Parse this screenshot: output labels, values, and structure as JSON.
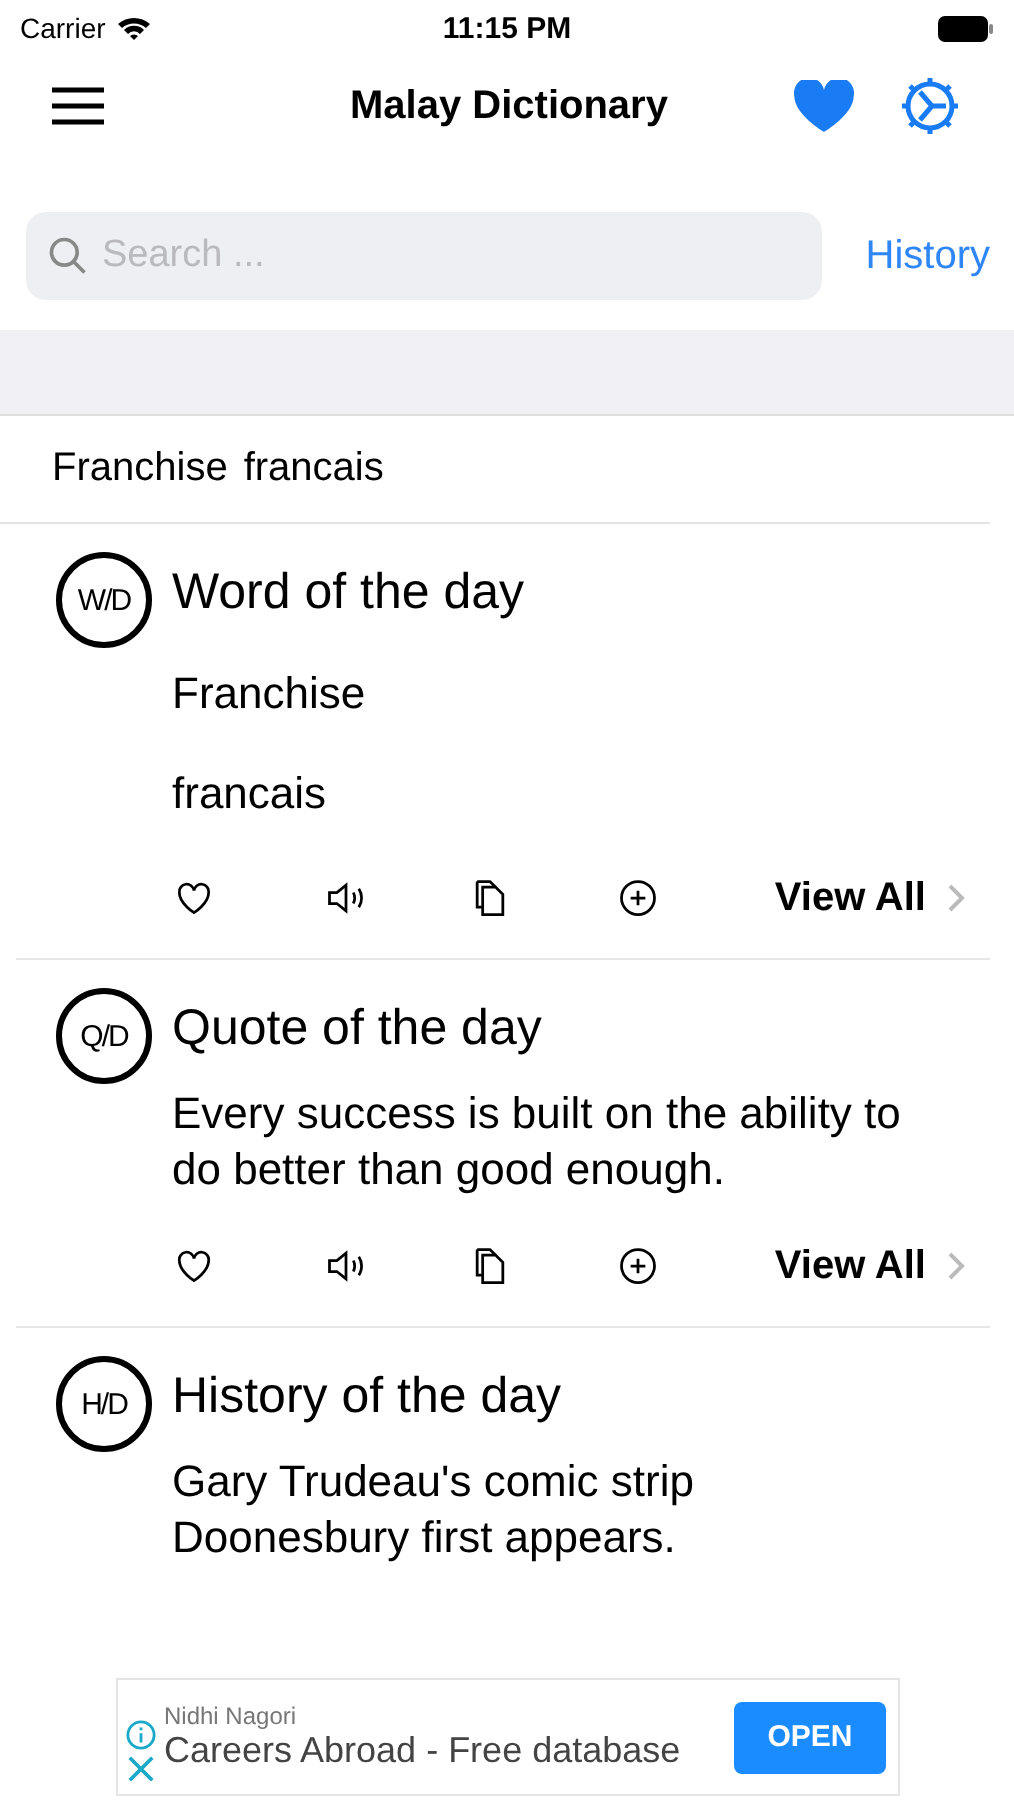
{
  "status_bar": {
    "carrier": "Carrier",
    "time": "11:15 PM"
  },
  "nav": {
    "title": "Malay Dictionary"
  },
  "search": {
    "placeholder": "Search ...",
    "history_link": "History"
  },
  "recent": {
    "word": "Franchise",
    "translation": "francais"
  },
  "cards": [
    {
      "badge": "W/D",
      "title": "Word of the day",
      "lines": [
        "Franchise",
        "francais"
      ],
      "actions": [
        {
          "kind": "heart"
        },
        {
          "kind": "speaker"
        },
        {
          "kind": "copy"
        },
        {
          "kind": "add"
        }
      ],
      "view_all": "View All"
    },
    {
      "badge": "Q/D",
      "title": "Quote of the day",
      "lines": [
        "Every success is built on the ability to do better than good enough."
      ],
      "actions": [
        {
          "kind": "heart"
        },
        {
          "kind": "speaker"
        },
        {
          "kind": "copy"
        },
        {
          "kind": "add"
        }
      ],
      "view_all": "View All"
    },
    {
      "badge": "H/D",
      "title": "History of the day",
      "lines": [
        "Gary Trudeau's comic strip Doonesbury first appears."
      ]
    }
  ],
  "ad": {
    "advertiser": "Nidhi Nagori",
    "headline": "Careers Abroad - Free database",
    "button": "OPEN"
  }
}
